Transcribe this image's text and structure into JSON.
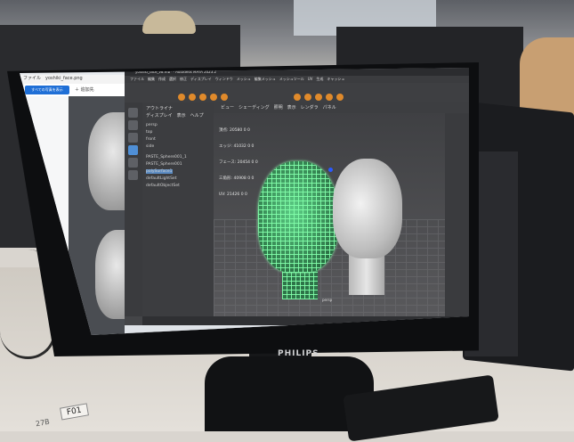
{
  "monitor": {
    "brand": "PHILIPS",
    "sticker": "F01",
    "sticker_small": "27B"
  },
  "viewer": {
    "tab_title": "ファイル　yoshiki_face.png",
    "primary_button": "すべての写真を表示",
    "add_button": "＋ 追加先"
  },
  "maya": {
    "title": "yoshiki_face_v8.mb* - Autodesk MAYA 2023.2",
    "menu": "ファイル　編集　作成　選択　修正　ディスプレイ　ウィンドウ　メッシュ　編集メッシュ　メッシュツール　UV　生成　キャッシュ",
    "viewport_menu": "ビュー　シェーディング　照明　表示　レンダラ　パネル",
    "outliner": {
      "header": "アウトライナ",
      "menu": "ディスプレイ　表示　ヘルプ",
      "items": [
        "persp",
        "top",
        "front",
        "side",
        "PASTE_Sphere001_1",
        "PASTE_Sphere001",
        "polySurface1",
        "defaultLightSet",
        "defaultObjectSet"
      ],
      "selected_index": 6
    },
    "hud": {
      "rows": [
        [
          "頂点:",
          "20580",
          "0",
          "0"
        ],
        [
          "エッジ:",
          "41032",
          "0",
          "0"
        ],
        [
          "フェース:",
          "20454",
          "0",
          "0"
        ],
        [
          "三角形:",
          "40908",
          "0",
          "0"
        ],
        [
          "UV:",
          "21426",
          "0",
          "0"
        ]
      ]
    },
    "camera_label": "persp"
  }
}
